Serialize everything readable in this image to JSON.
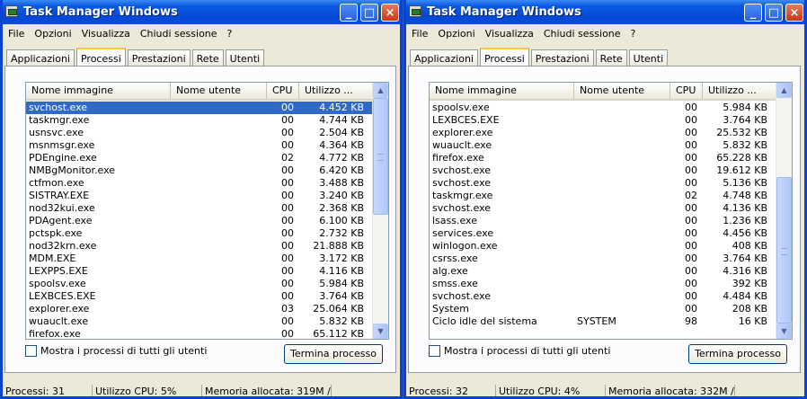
{
  "windows": [
    {
      "title": "Task Manager Windows",
      "menu": [
        "File",
        "Opzioni",
        "Visualizza",
        "Chiudi sessione",
        "?"
      ],
      "tabs": [
        "Applicazioni",
        "Processi",
        "Prestazioni",
        "Rete",
        "Utenti"
      ],
      "active_tab": 1,
      "columns": [
        "Nome immagine",
        "Nome utente",
        "CPU",
        "Utilizzo ..."
      ],
      "rows": [
        {
          "name": "svchost.exe",
          "user": "",
          "cpu": "00",
          "mem": "4.452 KB",
          "selected": true
        },
        {
          "name": "taskmgr.exe",
          "user": "",
          "cpu": "00",
          "mem": "4.744 KB"
        },
        {
          "name": "usnsvc.exe",
          "user": "",
          "cpu": "00",
          "mem": "2.504 KB"
        },
        {
          "name": "msnmsgr.exe",
          "user": "",
          "cpu": "00",
          "mem": "4.364 KB"
        },
        {
          "name": "PDEngine.exe",
          "user": "",
          "cpu": "02",
          "mem": "4.772 KB"
        },
        {
          "name": "NMBgMonitor.exe",
          "user": "",
          "cpu": "00",
          "mem": "6.420 KB"
        },
        {
          "name": "ctfmon.exe",
          "user": "",
          "cpu": "00",
          "mem": "3.488 KB"
        },
        {
          "name": "SISTRAY.EXE",
          "user": "",
          "cpu": "00",
          "mem": "3.240 KB"
        },
        {
          "name": "nod32kui.exe",
          "user": "",
          "cpu": "00",
          "mem": "2.368 KB"
        },
        {
          "name": "PDAgent.exe",
          "user": "",
          "cpu": "00",
          "mem": "6.100 KB"
        },
        {
          "name": "pctspk.exe",
          "user": "",
          "cpu": "00",
          "mem": "2.732 KB"
        },
        {
          "name": "nod32krn.exe",
          "user": "",
          "cpu": "00",
          "mem": "21.888 KB"
        },
        {
          "name": "MDM.EXE",
          "user": "",
          "cpu": "00",
          "mem": "3.172 KB"
        },
        {
          "name": "LEXPPS.EXE",
          "user": "",
          "cpu": "00",
          "mem": "4.116 KB"
        },
        {
          "name": "spoolsv.exe",
          "user": "",
          "cpu": "00",
          "mem": "5.984 KB"
        },
        {
          "name": "LEXBCES.EXE",
          "user": "",
          "cpu": "00",
          "mem": "3.764 KB"
        },
        {
          "name": "explorer.exe",
          "user": "",
          "cpu": "03",
          "mem": "25.064 KB"
        },
        {
          "name": "wuauclt.exe",
          "user": "",
          "cpu": "00",
          "mem": "5.832 KB"
        },
        {
          "name": "firefox.exe",
          "user": "",
          "cpu": "00",
          "mem": "65.112 KB"
        }
      ],
      "show_all_label": "Mostra i processi di tutti gli utenti",
      "end_process_label": "Termina processo",
      "status": [
        "Processi: 31",
        "Utilizzo CPU: 5%",
        "Memoria allocata: 319M /"
      ]
    },
    {
      "title": "Task Manager Windows",
      "menu": [
        "File",
        "Opzioni",
        "Visualizza",
        "Chiudi sessione",
        "?"
      ],
      "tabs": [
        "Applicazioni",
        "Processi",
        "Prestazioni",
        "Rete",
        "Utenti"
      ],
      "active_tab": 1,
      "columns": [
        "Nome immagine",
        "Nome utente",
        "CPU",
        "Utilizzo ..."
      ],
      "rows": [
        {
          "name": "spoolsv.exe",
          "user": "",
          "cpu": "00",
          "mem": "5.984 KB"
        },
        {
          "name": "LEXBCES.EXE",
          "user": "",
          "cpu": "00",
          "mem": "3.764 KB"
        },
        {
          "name": "explorer.exe",
          "user": "",
          "cpu": "00",
          "mem": "25.532 KB"
        },
        {
          "name": "wuauclt.exe",
          "user": "",
          "cpu": "00",
          "mem": "5.832 KB"
        },
        {
          "name": "firefox.exe",
          "user": "",
          "cpu": "00",
          "mem": "65.228 KB"
        },
        {
          "name": "svchost.exe",
          "user": "",
          "cpu": "00",
          "mem": "19.612 KB"
        },
        {
          "name": "svchost.exe",
          "user": "",
          "cpu": "00",
          "mem": "5.136 KB"
        },
        {
          "name": "taskmgr.exe",
          "user": "",
          "cpu": "02",
          "mem": "4.748 KB"
        },
        {
          "name": "svchost.exe",
          "user": "",
          "cpu": "00",
          "mem": "4.136 KB"
        },
        {
          "name": "lsass.exe",
          "user": "",
          "cpu": "00",
          "mem": "1.236 KB"
        },
        {
          "name": "services.exe",
          "user": "",
          "cpu": "00",
          "mem": "4.456 KB"
        },
        {
          "name": "winlogon.exe",
          "user": "",
          "cpu": "00",
          "mem": "408 KB"
        },
        {
          "name": "csrss.exe",
          "user": "",
          "cpu": "00",
          "mem": "3.764 KB"
        },
        {
          "name": "alg.exe",
          "user": "",
          "cpu": "00",
          "mem": "4.316 KB"
        },
        {
          "name": "smss.exe",
          "user": "",
          "cpu": "00",
          "mem": "392 KB"
        },
        {
          "name": "svchost.exe",
          "user": "",
          "cpu": "00",
          "mem": "4.484 KB"
        },
        {
          "name": "System",
          "user": "",
          "cpu": "00",
          "mem": "208 KB"
        },
        {
          "name": "Ciclo idle del sistema",
          "user": "SYSTEM",
          "cpu": "98",
          "mem": "16 KB"
        }
      ],
      "show_all_label": "Mostra i processi di tutti gli utenti",
      "end_process_label": "Termina processo",
      "status": [
        "Processi: 32",
        "Utilizzo CPU: 4%",
        "Memoria allocata: 332M /"
      ]
    }
  ]
}
